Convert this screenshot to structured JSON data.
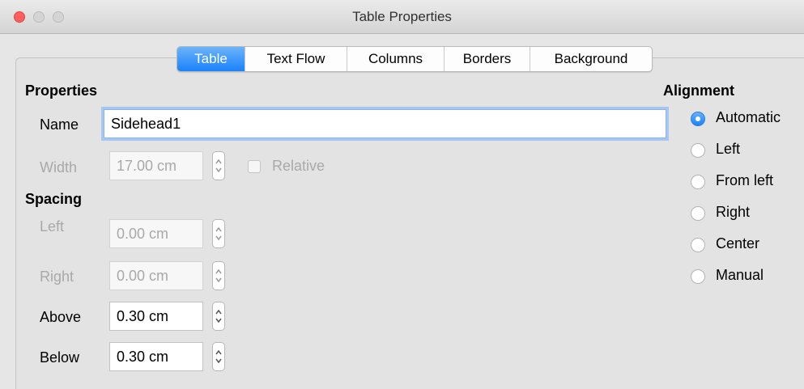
{
  "window": {
    "title": "Table Properties"
  },
  "tabs": [
    "Table",
    "Text Flow",
    "Columns",
    "Borders",
    "Background"
  ],
  "active_tab": "Table",
  "properties": {
    "heading": "Properties",
    "name_label": "Name",
    "name_value": "Sidehead1",
    "width_label": "Width",
    "width_value": "17.00 cm",
    "relative_label": "Relative",
    "relative_checked": false
  },
  "spacing": {
    "heading": "Spacing",
    "left_label": "Left",
    "left_value": "0.00 cm",
    "right_label": "Right",
    "right_value": "0.00 cm",
    "above_label": "Above",
    "above_value": "0.30 cm",
    "below_label": "Below",
    "below_value": "0.30 cm"
  },
  "alignment": {
    "heading": "Alignment",
    "options": [
      "Automatic",
      "Left",
      "From left",
      "Right",
      "Center",
      "Manual"
    ],
    "selected": "Automatic"
  },
  "colors": {
    "accent": "#1a82fb",
    "close": "#fc605c"
  }
}
